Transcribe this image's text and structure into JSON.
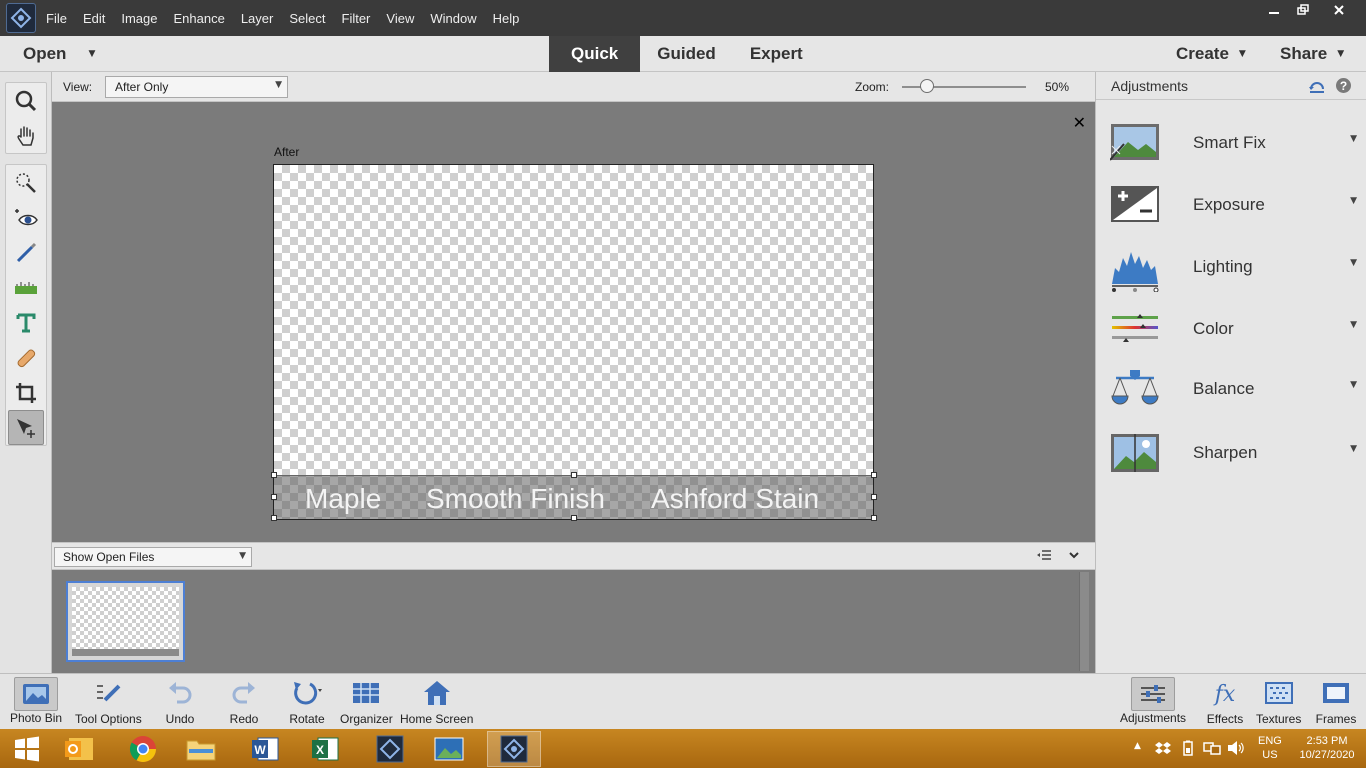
{
  "menubar": {
    "items": [
      "File",
      "Edit",
      "Image",
      "Enhance",
      "Layer",
      "Select",
      "Filter",
      "View",
      "Window",
      "Help"
    ],
    "window_controls": [
      "minimize",
      "restore",
      "close"
    ]
  },
  "modebar": {
    "open_label": "Open",
    "tabs": [
      "Quick",
      "Guided",
      "Expert"
    ],
    "active_tab": "Quick",
    "create_label": "Create",
    "share_label": "Share"
  },
  "options": {
    "view_label": "View:",
    "view_value": "After Only",
    "zoom_label": "Zoom:",
    "zoom_value": "50%",
    "zoom_level": 0.5
  },
  "canvas": {
    "after_label": "After",
    "text_items": [
      "Maple",
      "Smooth Finish",
      "Ashford Stain"
    ]
  },
  "photobin": {
    "select_value": "Show Open Files"
  },
  "panel": {
    "title": "Adjustments",
    "items": [
      {
        "label": "Smart Fix",
        "icon": "smart-fix-icon"
      },
      {
        "label": "Exposure",
        "icon": "exposure-icon"
      },
      {
        "label": "Lighting",
        "icon": "lighting-icon"
      },
      {
        "label": "Color",
        "icon": "color-icon"
      },
      {
        "label": "Balance",
        "icon": "balance-icon"
      },
      {
        "label": "Sharpen",
        "icon": "sharpen-icon"
      }
    ]
  },
  "toolbar_bottom": {
    "left": [
      "Photo Bin",
      "Tool Options",
      "Undo",
      "Redo",
      "Rotate",
      "Organizer",
      "Home Screen"
    ],
    "right": [
      "Adjustments",
      "Effects",
      "Textures",
      "Frames"
    ]
  },
  "tray": {
    "lang_1": "ENG",
    "lang_2": "US",
    "time": "2:53 PM",
    "date": "10/27/2020"
  },
  "colors": {
    "accent": "#3f6fb7",
    "dark_bar": "#3a3a3a",
    "workspace": "#7b7b7b",
    "taskbar": "#c78621"
  }
}
